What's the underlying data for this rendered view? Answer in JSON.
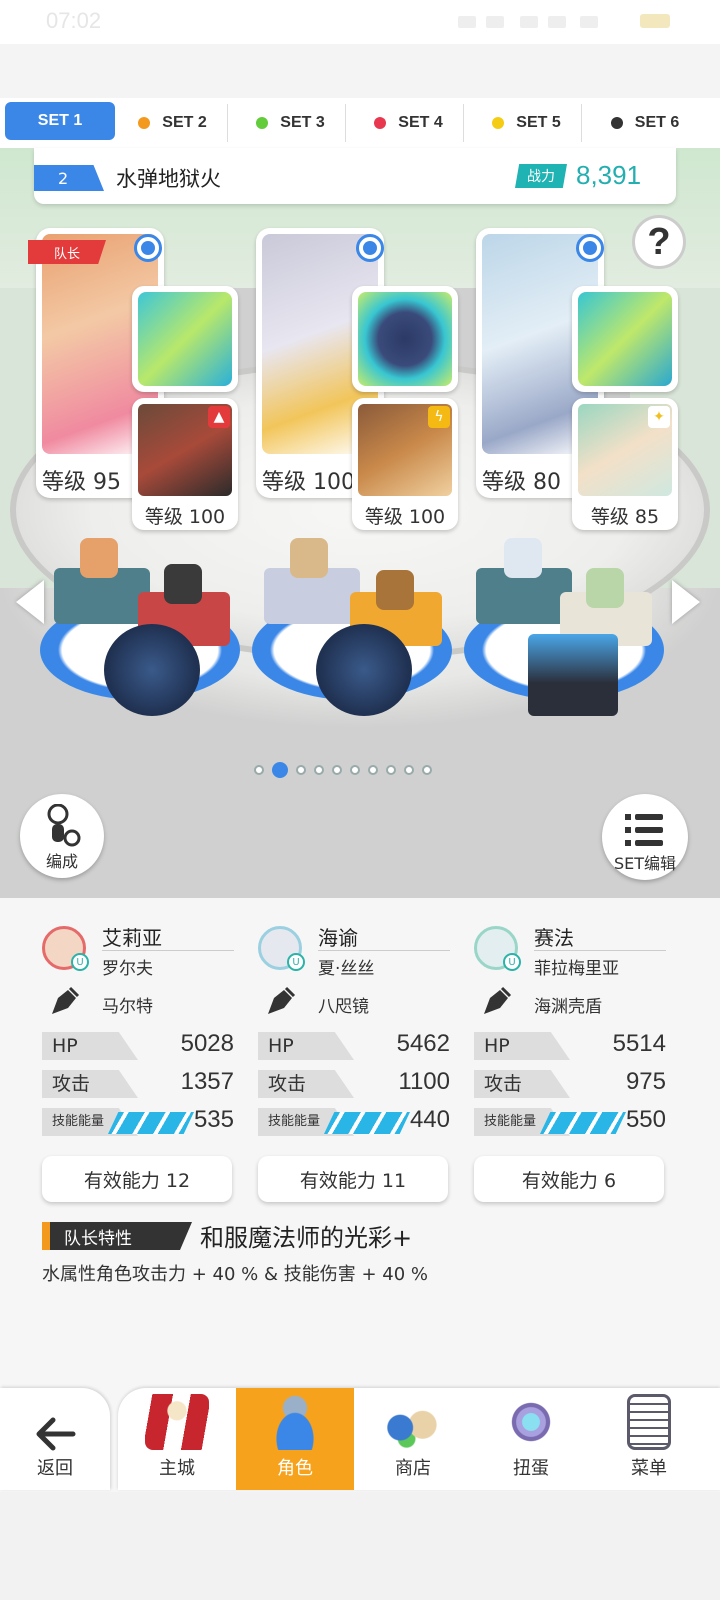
{
  "status_bar": {
    "time": "07:02"
  },
  "set_tabs": [
    {
      "label": "SET 1",
      "color": "#3b87e8",
      "active": true
    },
    {
      "label": "SET 2",
      "color": "#f39a1e"
    },
    {
      "label": "SET 3",
      "color": "#62cc3a"
    },
    {
      "label": "SET 4",
      "color": "#e8384f"
    },
    {
      "label": "SET 5",
      "color": "#f5cc14"
    },
    {
      "label": "SET 6",
      "color": "#333333"
    }
  ],
  "team": {
    "number": "2",
    "name": "水弹地狱火",
    "power_label": "战力",
    "power_value": "8,391"
  },
  "help_label": "?",
  "characters": [
    {
      "leader_flag": "队长",
      "level": "等级 95",
      "support_level": "等级 100"
    },
    {
      "level": "等级 100",
      "support_level": "等级 100"
    },
    {
      "level": "等级 80",
      "support_level": "等级 85"
    }
  ],
  "pager": {
    "count": 10,
    "current": 1
  },
  "buttons": {
    "formation": "编成",
    "set_edit": "SET编辑"
  },
  "stats": [
    {
      "name": "艾莉亚",
      "sub": "罗尔夫",
      "weapon": "马尔特",
      "hp_label": "HP",
      "hp": "5028",
      "atk_label": "攻击",
      "atk": "1357",
      "energy_label": "技能能量",
      "energy": "535",
      "effective": "有效能力 12"
    },
    {
      "name": "海谕",
      "sub": "夏·丝丝",
      "weapon": "八咫镜",
      "hp_label": "HP",
      "hp": "5462",
      "atk_label": "攻击",
      "atk": "1100",
      "energy_label": "技能能量",
      "energy": "440",
      "effective": "有效能力 11"
    },
    {
      "name": "赛法",
      "sub": "菲拉梅里亚",
      "weapon": "海渊壳盾",
      "hp_label": "HP",
      "hp": "5514",
      "atk_label": "攻击",
      "atk": "975",
      "energy_label": "技能能量",
      "energy": "550",
      "effective": "有效能力 6"
    }
  ],
  "leader_trait": {
    "tag": "队长特性",
    "name": "和服魔法师的光彩+",
    "desc": "水属性角色攻击力 + 40 % & 技能伤害 + 40 %"
  },
  "nav": {
    "back": "返回",
    "items": [
      {
        "label": "主城"
      },
      {
        "label": "角色",
        "active": true
      },
      {
        "label": "商店"
      },
      {
        "label": "扭蛋"
      },
      {
        "label": "菜单"
      }
    ]
  }
}
